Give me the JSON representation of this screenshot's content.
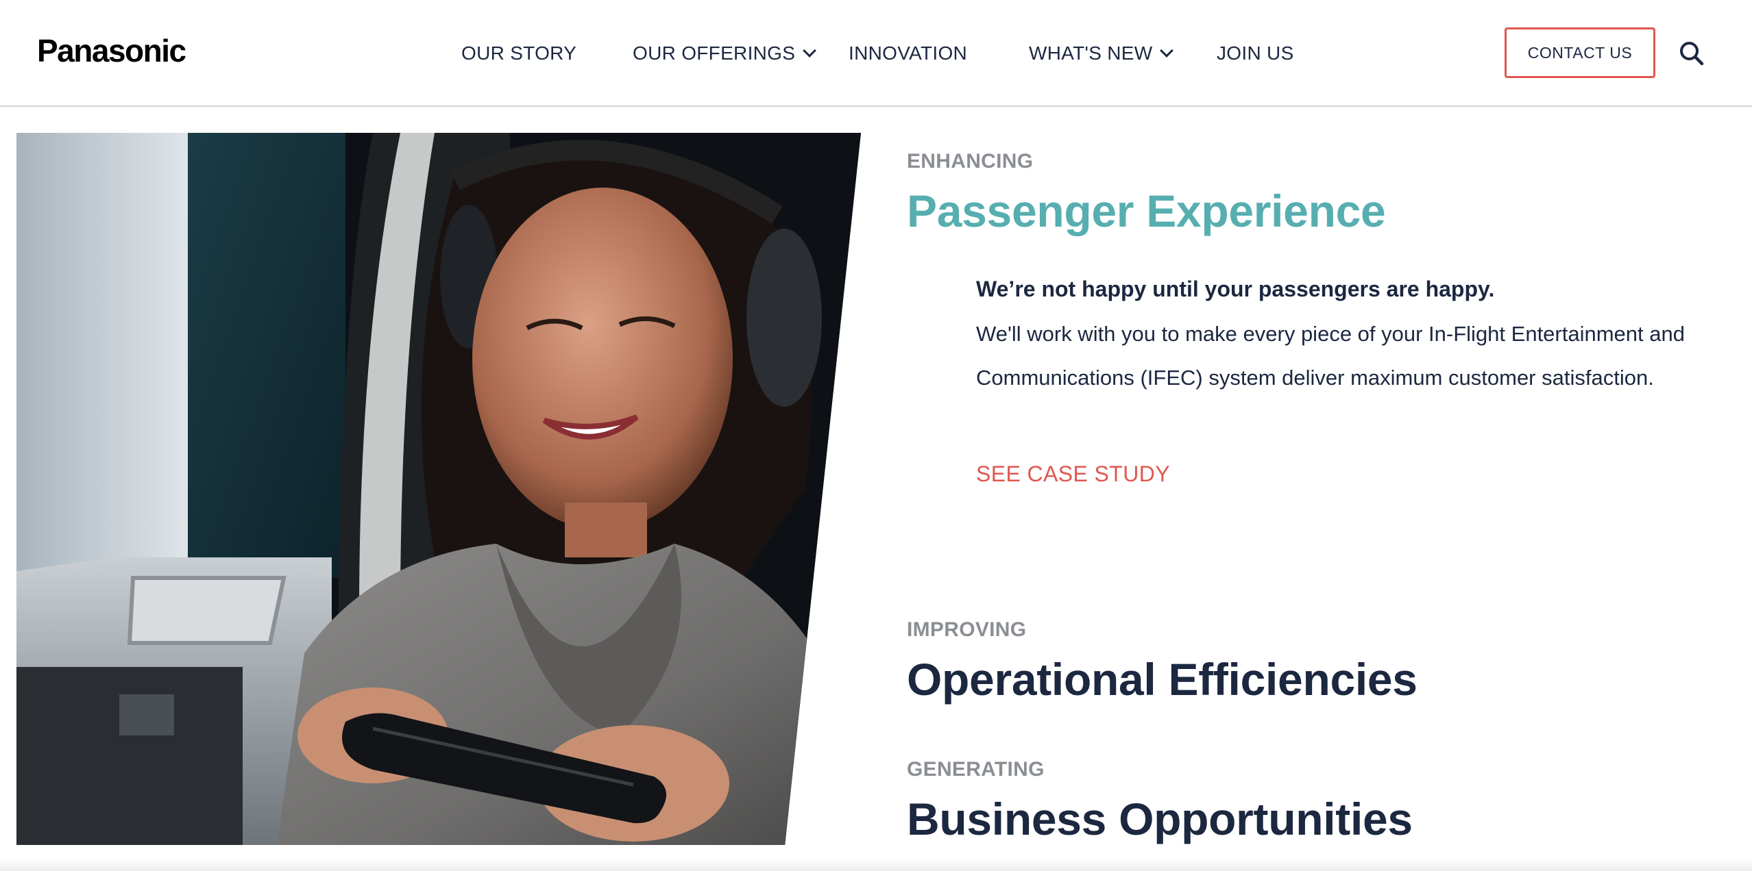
{
  "header": {
    "logo": "Panasonic",
    "nav": [
      {
        "label": "OUR STORY",
        "has_dropdown": false
      },
      {
        "label": "OUR OFFERINGS",
        "has_dropdown": true
      },
      {
        "label": "INNOVATION",
        "has_dropdown": false
      },
      {
        "label": "WHAT'S NEW",
        "has_dropdown": true
      },
      {
        "label": "JOIN US",
        "has_dropdown": false
      }
    ],
    "contact_label": "CONTACT US",
    "search_icon": "search-icon"
  },
  "hero": {
    "image": "woman-with-headphones-holding-handheld-controller-in-aircraft-seat"
  },
  "sections": [
    {
      "eyebrow": "ENHANCING",
      "heading": "Passenger Experience",
      "active": true,
      "tagline": "We’re not happy until your passengers are happy.",
      "body": "We'll work with you to make every piece of your In-Flight Entertainment and Communications (IFEC) system deliver maximum customer satisfaction.",
      "link_label": "SEE CASE STUDY"
    },
    {
      "eyebrow": "IMPROVING",
      "heading": "Operational Efficiencies",
      "active": false
    },
    {
      "eyebrow": "GENERATING",
      "heading": "Business Opportunities",
      "active": false
    }
  ],
  "colors": {
    "accent_teal": "#57aeb0",
    "accent_coral": "#e0574f",
    "navy": "#1c2740",
    "eyebrow_gray": "#8b8e93"
  }
}
